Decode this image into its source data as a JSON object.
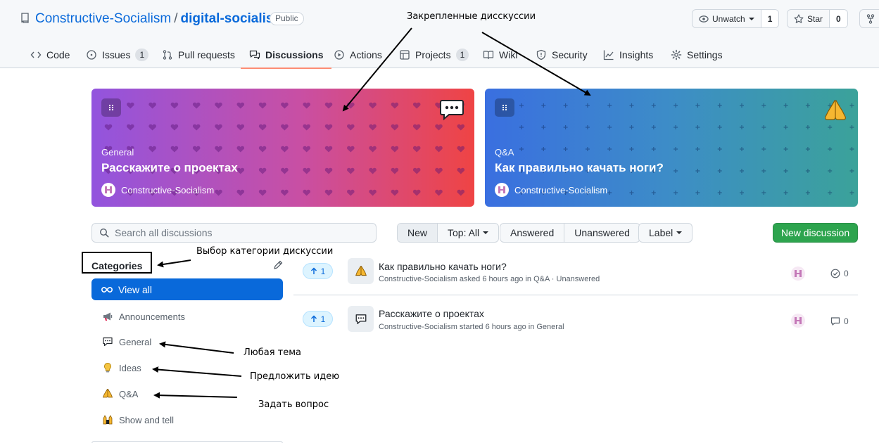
{
  "repo": {
    "owner": "Constructive-Socialism",
    "separator": "/",
    "name": "digital-socialism",
    "visibility": "Public"
  },
  "actions": {
    "watch_label": "Unwatch",
    "watch_count": "1",
    "star_label": "Star",
    "star_count": "0"
  },
  "tabs": [
    {
      "label": "Code",
      "icon": "code-icon"
    },
    {
      "label": "Issues",
      "icon": "issue-icon",
      "count": "1"
    },
    {
      "label": "Pull requests",
      "icon": "pull-request-icon"
    },
    {
      "label": "Discussions",
      "icon": "discussions-icon",
      "active": true
    },
    {
      "label": "Actions",
      "icon": "play-icon"
    },
    {
      "label": "Projects",
      "icon": "table-icon",
      "count": "1"
    },
    {
      "label": "Wiki",
      "icon": "book-icon"
    },
    {
      "label": "Security",
      "icon": "shield-icon"
    },
    {
      "label": "Insights",
      "icon": "graph-icon"
    },
    {
      "label": "Settings",
      "icon": "gear-icon"
    }
  ],
  "pinned": [
    {
      "category": "General",
      "title": "Расскажите о проектах",
      "author": "Constructive-Socialism",
      "emoji": "speech-balloon-icon",
      "pattern": "hearts"
    },
    {
      "category": "Q&A",
      "title": "Как правильно качать ноги?",
      "author": "Constructive-Socialism",
      "emoji": "folded-hands-icon",
      "pattern": "plus"
    }
  ],
  "toolbar": {
    "search_placeholder": "Search all discussions",
    "sort_new": "New",
    "sort_top": "Top: All",
    "answered": "Answered",
    "unanswered": "Unanswered",
    "label": "Label",
    "new_discussion": "New discussion"
  },
  "categories": {
    "title": "Categories",
    "view_all": "View all",
    "items": [
      {
        "label": "Announcements",
        "icon": "megaphone-icon"
      },
      {
        "label": "General",
        "icon": "speech-balloon-icon"
      },
      {
        "label": "Ideas",
        "icon": "light-bulb-icon"
      },
      {
        "label": "Q&A",
        "icon": "folded-hands-icon"
      },
      {
        "label": "Show and tell",
        "icon": "raising-hands-icon"
      }
    ]
  },
  "discussions": [
    {
      "upvotes": "1",
      "title": "Как правильно качать ноги?",
      "meta": "Constructive-Socialism asked 6 hours ago in Q&A · Unanswered",
      "stat": "0",
      "stat_icon": "check-circle-icon",
      "icon": "folded-hands-icon"
    },
    {
      "upvotes": "1",
      "title": "Расскажите о проектах",
      "meta": "Constructive-Socialism started 6 hours ago in General",
      "stat": "0",
      "stat_icon": "comment-icon",
      "icon": "speech-balloon-icon"
    }
  ],
  "annotations": {
    "pinned": "Закрепленные дисскуссии",
    "category_select": "Выбор категории дискуссии",
    "any_topic": "Любая тема",
    "suggest_idea": "Предложить идею",
    "ask_question": "Задать вопрос"
  },
  "colors": {
    "accent": "#0969da",
    "primary_button": "#2da44e",
    "tab_underline": "#fd8c73"
  }
}
